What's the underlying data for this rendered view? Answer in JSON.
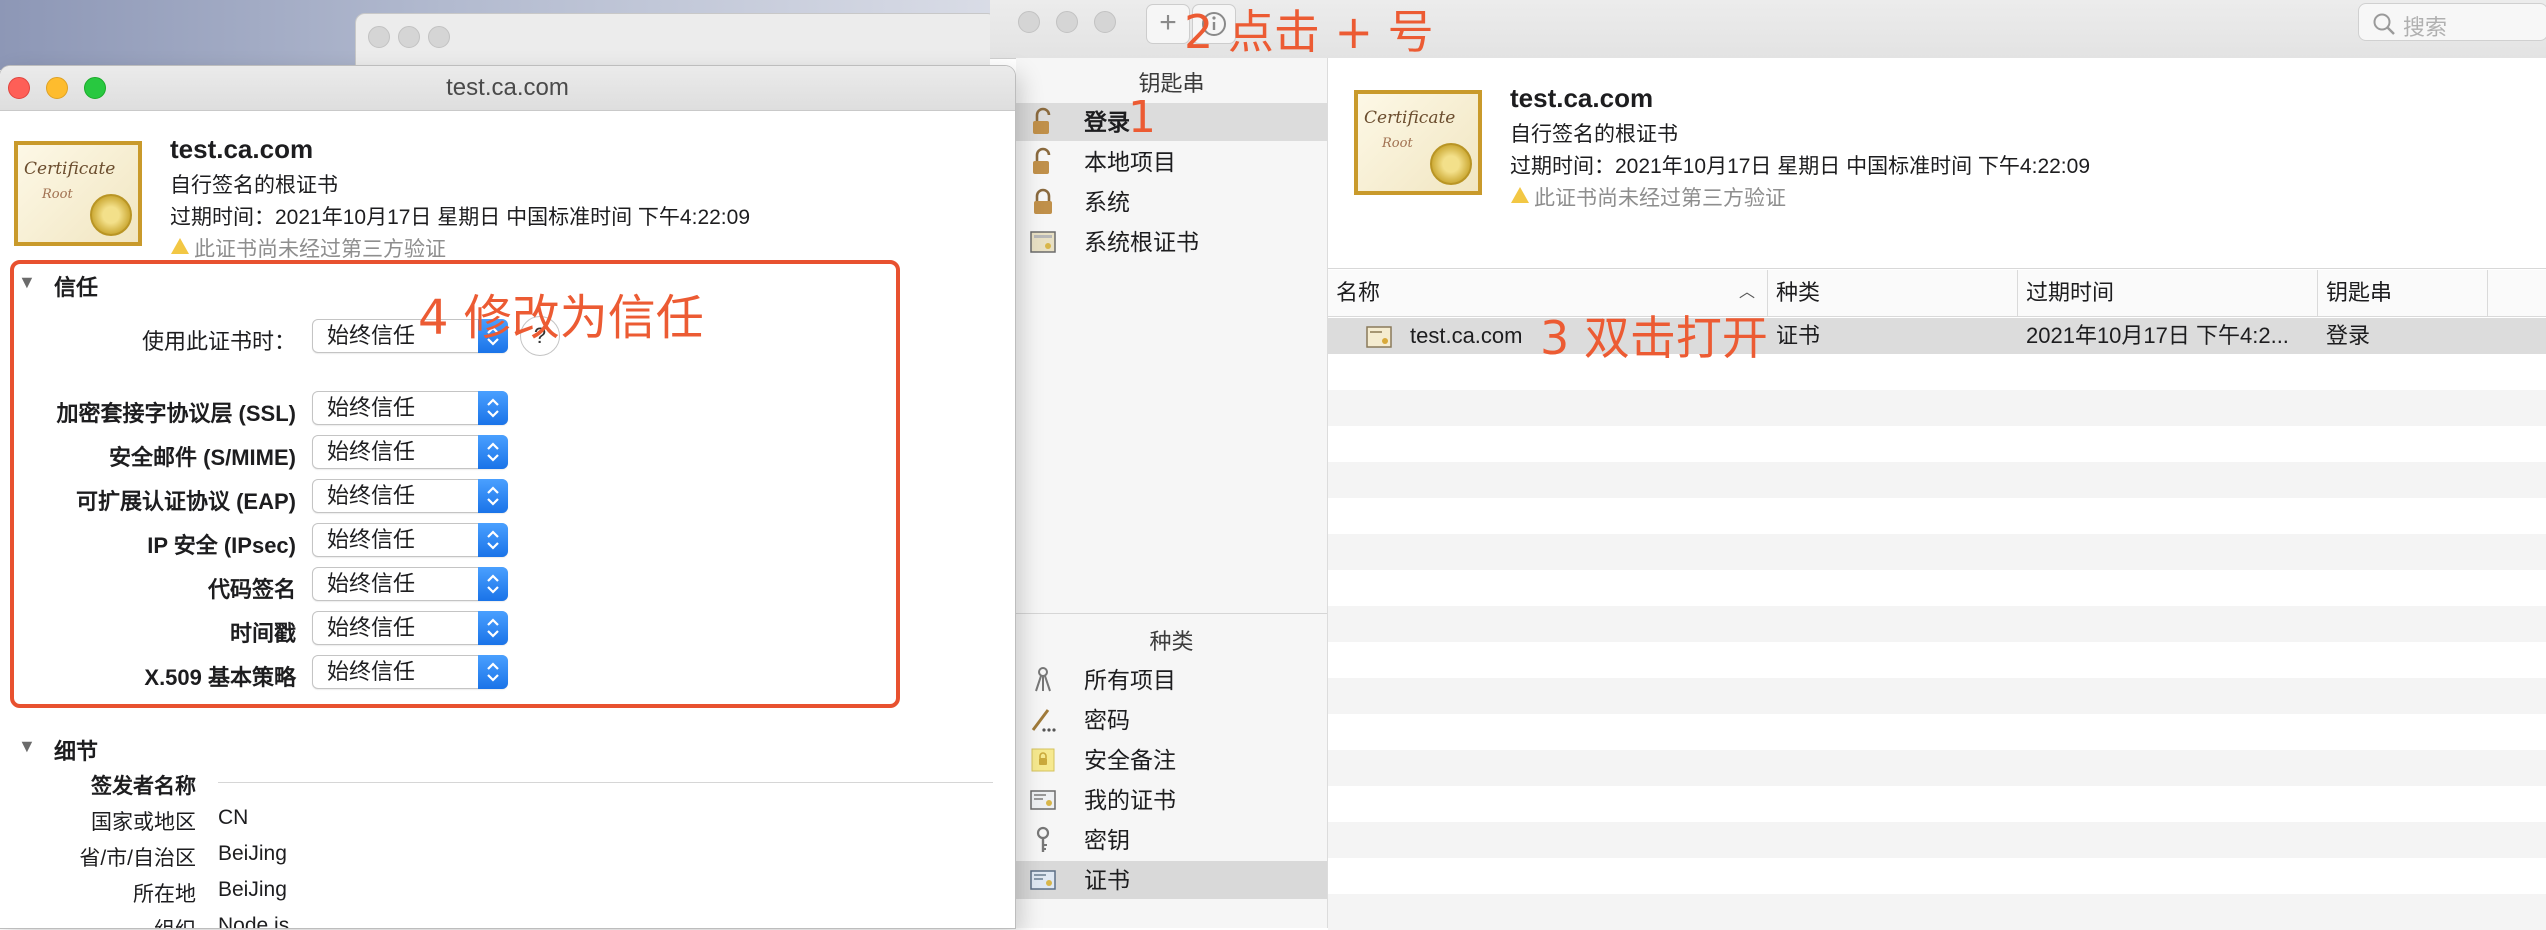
{
  "keychain_window": {
    "toolbar": {
      "add_button_glyph": "+",
      "search_placeholder": "搜索"
    },
    "sidebar": {
      "keychains_header": "钥匙串",
      "keychains": [
        {
          "label": "登录",
          "icon": "lock-open-icon",
          "selected": true
        },
        {
          "label": "本地项目",
          "icon": "lock-open-icon"
        },
        {
          "label": "系统",
          "icon": "lock-icon"
        },
        {
          "label": "系统根证书",
          "icon": "certificate-cabinet-icon"
        }
      ],
      "categories_header": "种类",
      "categories": [
        {
          "label": "所有项目",
          "icon": "all-items-icon"
        },
        {
          "label": "密码",
          "icon": "password-icon"
        },
        {
          "label": "安全备注",
          "icon": "secure-note-icon"
        },
        {
          "label": "我的证书",
          "icon": "my-certificate-icon"
        },
        {
          "label": "密钥",
          "icon": "key-icon"
        },
        {
          "label": "证书",
          "icon": "certificate-icon",
          "selected": true
        }
      ]
    },
    "detail": {
      "name": "test.ca.com",
      "kind": "自行签名的根证书",
      "expiry": "过期时间：2021年10月17日 星期日 中国标准时间 下午4:22:09",
      "warning": "此证书尚未经过第三方验证"
    },
    "table": {
      "columns": [
        "名称",
        "种类",
        "过期时间",
        "钥匙串"
      ],
      "rows": [
        {
          "name": "test.ca.com",
          "kind": "证书",
          "expires": "2021年10月17日 下午4:2...",
          "keychain": "登录"
        }
      ]
    }
  },
  "cert_window": {
    "title": "test.ca.com",
    "cert_name": "test.ca.com",
    "cert_kind": "自行签名的根证书",
    "expiry": "过期时间：2021年10月17日 星期日 中国标准时间 下午4:22:09",
    "warning": "此证书尚未经过第三方验证",
    "trust": {
      "section_label": "信任",
      "when_using_label": "使用此证书时：",
      "when_using_value": "始终信任",
      "help_glyph": "?",
      "rows": [
        {
          "label": "加密套接字协议层 (SSL)",
          "value": "始终信任"
        },
        {
          "label": "安全邮件 (S/MIME)",
          "value": "始终信任"
        },
        {
          "label": "可扩展认证协议 (EAP)",
          "value": "始终信任"
        },
        {
          "label": "IP 安全 (IPsec)",
          "value": "始终信任"
        },
        {
          "label": "代码签名",
          "value": "始终信任"
        },
        {
          "label": "时间戳",
          "value": "始终信任"
        },
        {
          "label": "X.509 基本策略",
          "value": "始终信任"
        }
      ]
    },
    "details": {
      "section_label": "细节",
      "issuer_header": "签发者名称",
      "fields": [
        {
          "label": "国家或地区",
          "value": "CN"
        },
        {
          "label": "省/市/自治区",
          "value": "BeiJing"
        },
        {
          "label": "所在地",
          "value": "BeiJing"
        },
        {
          "label": "组织",
          "value": "Node.js"
        }
      ]
    }
  },
  "annotations": {
    "step1": "1",
    "step2": "2 点击 + 号",
    "step3": "3 双击打开",
    "step4": "4 修改为信任",
    "color": "#ec5b33"
  },
  "cert_icon_text": {
    "line1": "Certificate",
    "line2": "Root"
  }
}
